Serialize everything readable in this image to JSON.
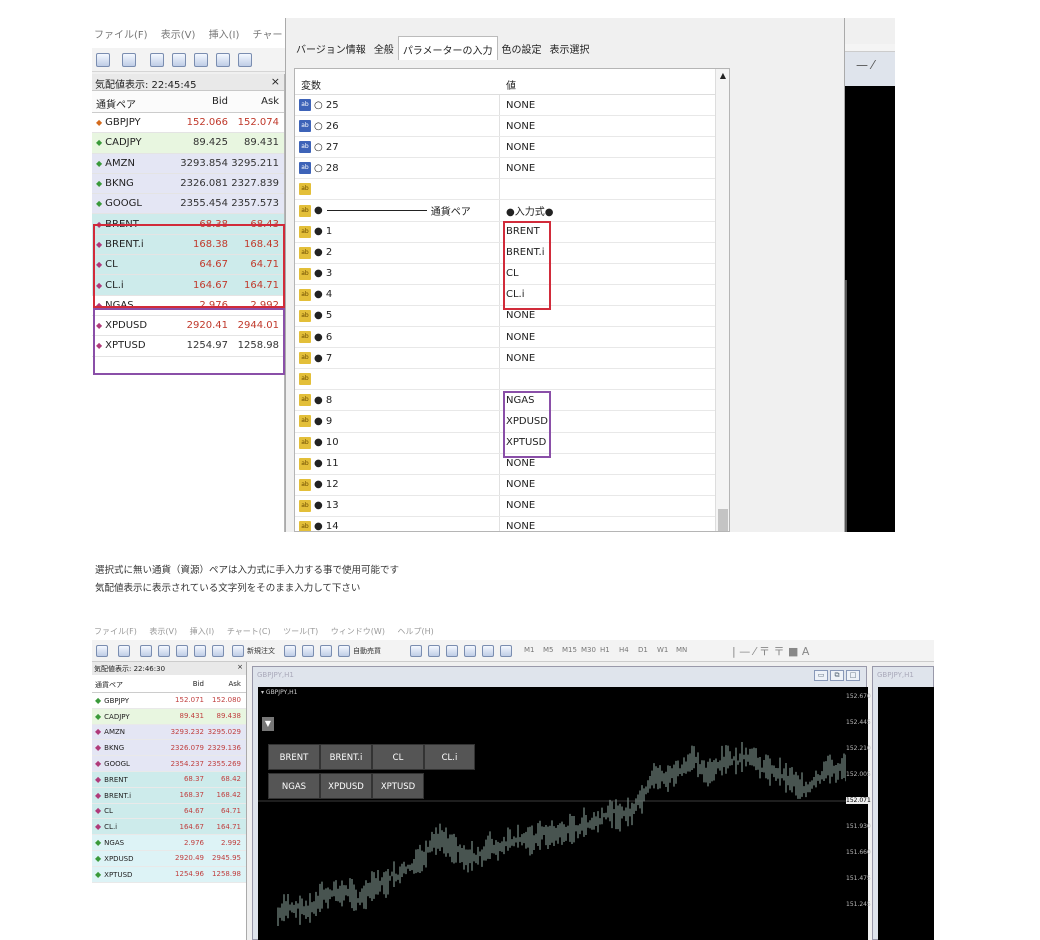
{
  "top": {
    "menu": [
      "ファイル(F)",
      "表示(V)",
      "挿入(I)",
      "チャート(C)"
    ],
    "quote_panel": {
      "title": "気配値表示: 22:45:45",
      "close": "×",
      "headers": {
        "symbol": "通貨ペア",
        "bid": "Bid",
        "ask": "Ask"
      },
      "rows": [
        {
          "symbol": "GBPJPY",
          "bid": "152.066",
          "ask": "152.074",
          "bg": "#ffffff",
          "bid_color": "#c0392b",
          "ask_color": "#c0392b",
          "arrow_color": "#d46a1c"
        },
        {
          "symbol": "CADJPY",
          "bid": "89.425",
          "ask": "89.431",
          "bg": "#e8f6e0",
          "bid_color": "#333333",
          "ask_color": "#333333",
          "arrow_color": "#3a9a3a"
        },
        {
          "symbol": "AMZN",
          "bid": "3293.854",
          "ask": "3295.211",
          "bg": "#e4e6f4",
          "bid_color": "#333333",
          "ask_color": "#333333",
          "arrow_color": "#3a9a3a"
        },
        {
          "symbol": "BKNG",
          "bid": "2326.081",
          "ask": "2327.839",
          "bg": "#e4e6f4",
          "bid_color": "#333333",
          "ask_color": "#333333",
          "arrow_color": "#3a9a3a"
        },
        {
          "symbol": "GOOGL",
          "bid": "2355.454",
          "ask": "2357.573",
          "bg": "#e4e6f4",
          "bid_color": "#333333",
          "ask_color": "#333333",
          "arrow_color": "#3a9a3a"
        },
        {
          "symbol": "BRENT",
          "bid": "68.38",
          "ask": "68.43",
          "bg": "#cdebeb",
          "bid_color": "#c0392b",
          "ask_color": "#c0392b",
          "arrow_color": "#b03a7a"
        },
        {
          "symbol": "BRENT.i",
          "bid": "168.38",
          "ask": "168.43",
          "bg": "#cdebeb",
          "bid_color": "#c0392b",
          "ask_color": "#c0392b",
          "arrow_color": "#b03a7a"
        },
        {
          "symbol": "CL",
          "bid": "64.67",
          "ask": "64.71",
          "bg": "#cdebeb",
          "bid_color": "#c0392b",
          "ask_color": "#c0392b",
          "arrow_color": "#b03a7a"
        },
        {
          "symbol": "CL.i",
          "bid": "164.67",
          "ask": "164.71",
          "bg": "#cdebeb",
          "bid_color": "#c0392b",
          "ask_color": "#c0392b",
          "arrow_color": "#b03a7a"
        },
        {
          "symbol": "NGAS",
          "bid": "2.976",
          "ask": "2.992",
          "bg": "#ffffff",
          "bid_color": "#c0392b",
          "ask_color": "#c0392b",
          "arrow_color": "#b03a7a"
        },
        {
          "symbol": "XPDUSD",
          "bid": "2920.41",
          "ask": "2944.01",
          "bg": "#ffffff",
          "bid_color": "#c0392b",
          "ask_color": "#c0392b",
          "arrow_color": "#b03a7a"
        },
        {
          "symbol": "XPTUSD",
          "bid": "1254.97",
          "ask": "1258.98",
          "bg": "#ffffff",
          "bid_color": "#333333",
          "ask_color": "#333333",
          "arrow_color": "#b03a7a"
        }
      ]
    },
    "dialog": {
      "tabs": [
        {
          "label": "バージョン情報",
          "active": false
        },
        {
          "label": "全般",
          "active": false
        },
        {
          "label": "パラメーターの入力",
          "active": true
        },
        {
          "label": "色の設定",
          "active": false
        },
        {
          "label": "表示選択",
          "active": false
        }
      ],
      "headers": {
        "variable": "変数",
        "value": "値"
      },
      "rows": [
        {
          "icon": "blue",
          "var": "○ 25",
          "value": "NONE"
        },
        {
          "icon": "blue",
          "var": "○ 26",
          "value": "NONE"
        },
        {
          "icon": "blue",
          "var": "○ 27",
          "value": "NONE"
        },
        {
          "icon": "blue",
          "var": "○ 28",
          "value": "NONE"
        },
        {
          "icon": "yellow",
          "var": "",
          "value": ""
        },
        {
          "icon": "yellow",
          "var": "●",
          "var_suffix": "通貨ペア",
          "separator": true,
          "value": "●入力式●"
        },
        {
          "icon": "yellow",
          "var": "● 1",
          "value": "BRENT"
        },
        {
          "icon": "yellow",
          "var": "● 2",
          "value": "BRENT.i"
        },
        {
          "icon": "yellow",
          "var": "● 3",
          "value": "CL"
        },
        {
          "icon": "yellow",
          "var": "● 4",
          "value": "CL.i"
        },
        {
          "icon": "yellow",
          "var": "● 5",
          "value": "NONE"
        },
        {
          "icon": "yellow",
          "var": "● 6",
          "value": "NONE"
        },
        {
          "icon": "yellow",
          "var": "● 7",
          "value": "NONE"
        },
        {
          "icon": "yellow",
          "var": "",
          "value": ""
        },
        {
          "icon": "yellow",
          "var": "● 8",
          "value": "NGAS"
        },
        {
          "icon": "yellow",
          "var": "● 9",
          "value": "XPDUSD"
        },
        {
          "icon": "yellow",
          "var": "● 10",
          "value": "XPTUSD"
        },
        {
          "icon": "yellow",
          "var": "● 11",
          "value": "NONE"
        },
        {
          "icon": "yellow",
          "var": "● 12",
          "value": "NONE"
        },
        {
          "icon": "yellow",
          "var": "● 13",
          "value": "NONE"
        },
        {
          "icon": "yellow",
          "var": "● 14",
          "value": "NONE"
        }
      ]
    },
    "chart_toolbar": "— ⁄"
  },
  "caption": {
    "line1": "選択式に無い通貨（資源）ペアは入力式に手入力する事で使用可能です",
    "line2": "気配値表示に表示されている文字列をそのまま入力して下さい"
  },
  "bottom": {
    "menu": [
      "ファイル(F)",
      "表示(V)",
      "挿入(I)",
      "チャート(C)",
      "ツール(T)",
      "ウィンドウ(W)",
      "ヘルプ(H)"
    ],
    "toolbar_labels": {
      "new_order": "新規注文",
      "auto_trade": "自動売買"
    },
    "timeframes": [
      "M1",
      "M5",
      "M15",
      "M30",
      "H1",
      "H4",
      "D1",
      "W1",
      "MN"
    ],
    "quote_panel": {
      "title": "気配値表示: 22:46:30",
      "close": "×",
      "headers": {
        "symbol": "通貨ペア",
        "bid": "Bid",
        "ask": "Ask"
      },
      "rows": [
        {
          "symbol": "GBPJPY",
          "bid": "152.071",
          "ask": "152.080",
          "bg": "#ffffff"
        },
        {
          "symbol": "CADJPY",
          "bid": "89.431",
          "ask": "89.438",
          "bg": "#e8f6e0"
        },
        {
          "symbol": "AMZN",
          "bid": "3293.232",
          "ask": "3295.029",
          "bg": "#e4e6f4"
        },
        {
          "symbol": "BKNG",
          "bid": "2326.079",
          "ask": "2329.136",
          "bg": "#e4e6f4"
        },
        {
          "symbol": "GOOGL",
          "bid": "2354.237",
          "ask": "2355.269",
          "bg": "#e4e6f4"
        },
        {
          "symbol": "BRENT",
          "bid": "68.37",
          "ask": "68.42",
          "bg": "#cdebeb"
        },
        {
          "symbol": "BRENT.i",
          "bid": "168.37",
          "ask": "168.42",
          "bg": "#cdebeb"
        },
        {
          "symbol": "CL",
          "bid": "64.67",
          "ask": "64.71",
          "bg": "#cdebeb"
        },
        {
          "symbol": "CL.i",
          "bid": "164.67",
          "ask": "164.71",
          "bg": "#cdebeb"
        },
        {
          "symbol": "NGAS",
          "bid": "2.976",
          "ask": "2.992",
          "bg": "#ddf3f6"
        },
        {
          "symbol": "XPDUSD",
          "bid": "2920.49",
          "ask": "2945.95",
          "bg": "#ddf3f6"
        },
        {
          "symbol": "XPTUSD",
          "bid": "1254.96",
          "ask": "1258.98",
          "bg": "#ddf3f6"
        }
      ]
    },
    "chart": {
      "title": "GBPJPY,H1",
      "sub_label": "▾ GBPJPY,H1",
      "dropdown": "▼",
      "buttons_row1": [
        "BRENT",
        "BRENT.i",
        "CL",
        "CL.i"
      ],
      "buttons_row2": [
        "NGAS",
        "XPDUSD",
        "XPTUSD"
      ],
      "price_axis": [
        "152.670",
        "152.445",
        "152.210",
        "152.005",
        "152.071",
        "151.930",
        "151.660",
        "151.475",
        "151.245"
      ],
      "second_chart_title": "GBPJPY,H1"
    }
  }
}
